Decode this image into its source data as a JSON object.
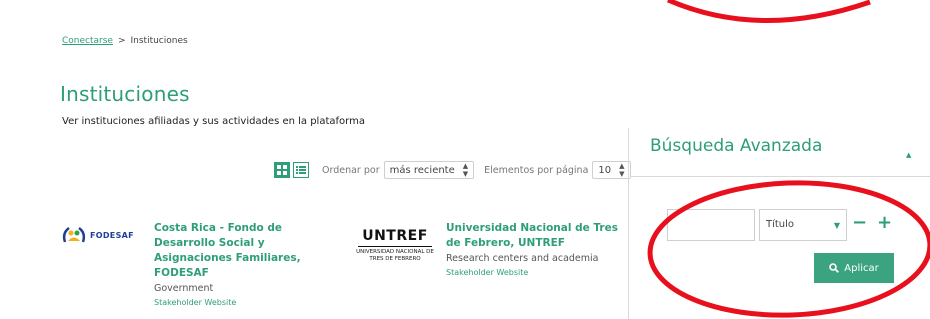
{
  "breadcrumb": {
    "home": "Conectarse",
    "separator": ">",
    "current": "Instituciones"
  },
  "page": {
    "title": "Instituciones",
    "subtitle": "Ver instituciones afiliadas y sus actividades en la plataforma"
  },
  "toolbar": {
    "order_label": "Ordenar por",
    "order_value": "más reciente",
    "per_page_label": "Elementos por página",
    "per_page_value": "10",
    "grid_icon": "grid-view-icon",
    "list_icon": "list-view-icon"
  },
  "advanced_search": {
    "title": "Búsqueda Avanzada",
    "query_value": "",
    "field_value": "Título",
    "apply_label": "Aplicar"
  },
  "institutions": [
    {
      "logo_text": "FODESAF",
      "title": "Costa Rica - Fondo de Desarrollo Social y Asignaciones Familiares, FODESAF",
      "type": "Government",
      "link": "Stakeholder Website"
    },
    {
      "logo_text": "UNTREF",
      "logo_subtext": "UNIVERSIDAD NACIONAL DE TRES DE FEBRERO",
      "title": "Universidad Nacional de Tres de Febrero, UNTREF",
      "type": "Research centers and academia",
      "link": "Stakeholder Website"
    }
  ],
  "colors": {
    "accent": "#2e9e78",
    "button": "#3ba37f",
    "annotation": "#e8101c"
  }
}
